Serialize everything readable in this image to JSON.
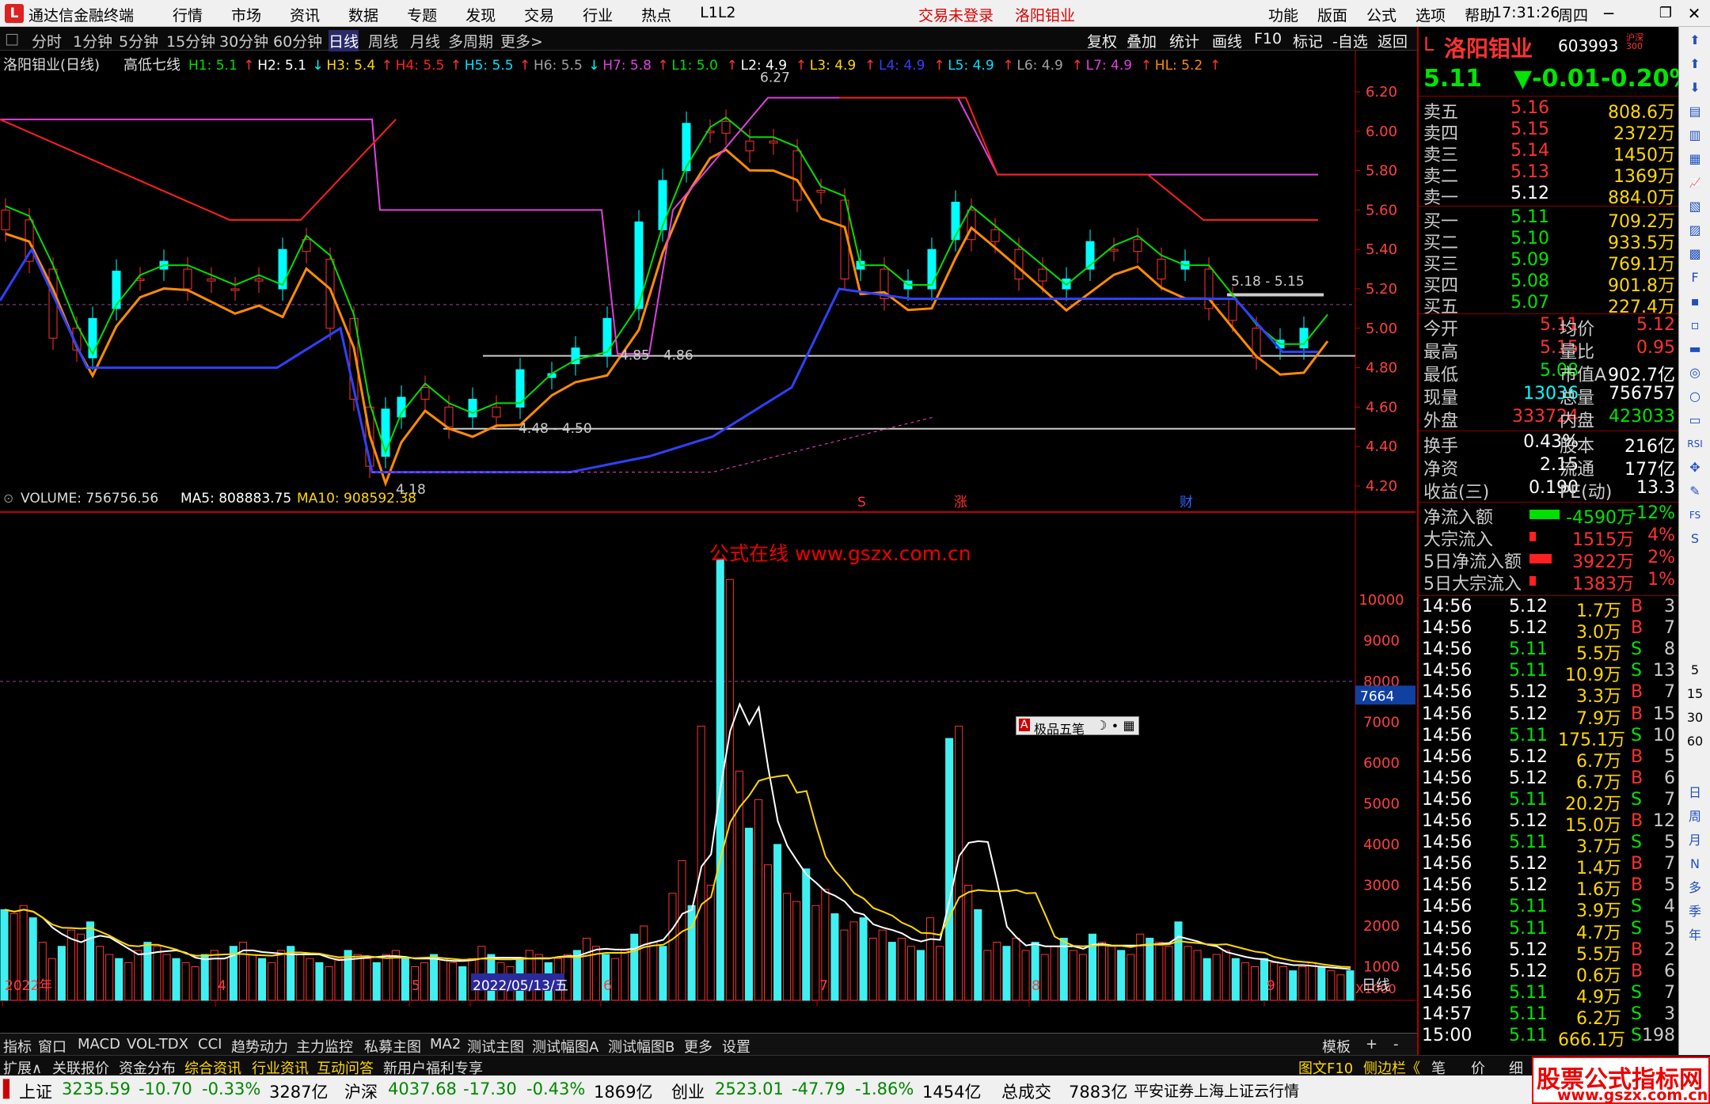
{
  "titlebar": {
    "app_title": "通达信金融终端",
    "menus": [
      "行情",
      "市场",
      "资讯",
      "数据",
      "专题",
      "发现",
      "交易",
      "行业",
      "热点",
      "L1L2"
    ],
    "trade_warning": "交易未登录",
    "stock_name": "洛阳钼业",
    "right_menus": [
      "功能",
      "版面",
      "公式",
      "选项",
      "帮助"
    ],
    "time": "17:31:26",
    "weekday": "周四"
  },
  "periodbar": {
    "items": [
      "分时",
      "1分钟",
      "5分钟",
      "15分钟",
      "30分钟",
      "60分钟",
      "日线",
      "周线",
      "月线",
      "多周期",
      "更多>"
    ],
    "selected": "日线",
    "right_items": [
      "复权",
      "叠加",
      "统计",
      "画线",
      "F10",
      "标记",
      "-自选",
      "返回"
    ]
  },
  "main": {
    "title": "洛阳钼业(日线)",
    "indicator": "高低七线",
    "params": [
      {
        "label": "H1: 5.1",
        "arrow": "↑",
        "color": "#00e000"
      },
      {
        "label": "H2: 5.1",
        "arrow": "↓",
        "color": "#ffffff"
      },
      {
        "label": "H3: 5.4",
        "arrow": "↑",
        "color": "#ffd800"
      },
      {
        "label": "H4: 5.5",
        "arrow": "↑",
        "color": "#ff2020"
      },
      {
        "label": "H5: 5.5",
        "arrow": "↑",
        "color": "#00e0ff"
      },
      {
        "label": "H6: 5.5",
        "arrow": "↓",
        "color": "#a0a0a0"
      },
      {
        "label": "H7: 5.8",
        "arrow": "↑",
        "color": "#e040e0"
      },
      {
        "label": "L1: 5.0",
        "arrow": "↑",
        "color": "#00e000"
      },
      {
        "label": "L2: 4.9",
        "arrow": "↑",
        "color": "#ffffff"
      },
      {
        "label": "L3: 4.9",
        "arrow": "↑",
        "color": "#ffd800"
      },
      {
        "label": "L4: 4.9",
        "arrow": "↑",
        "color": "#3040ff"
      },
      {
        "label": "L5: 4.9",
        "arrow": "↑",
        "color": "#00e0ff"
      },
      {
        "label": "L6: 4.9",
        "arrow": "↑",
        "color": "#a0a0a0"
      },
      {
        "label": "L7: 4.9",
        "arrow": "↑",
        "color": "#e040e0"
      },
      {
        "label": "HL: 5.2",
        "arrow": "↑",
        "color": "#ff8c00"
      }
    ],
    "yticks": [
      "6.20",
      "6.00",
      "5.80",
      "5.60",
      "5.40",
      "5.20",
      "5.00",
      "4.80",
      "4.60",
      "4.40",
      "4.20"
    ],
    "annotations": {
      "high": "6.27",
      "low": "4.18",
      "range1": "4.85 - 4.86",
      "range2": "4.48 - 4.50",
      "range3": "5.18 - 5.15"
    },
    "markers": [
      "S",
      "涨",
      "财"
    ]
  },
  "volume": {
    "label": "VOLUME: 756756.56",
    "ma5": "MA5: 808883.75",
    "ma10": "MA10: 908592.38",
    "yticks": [
      "10000",
      "9000",
      "8000",
      "7000",
      "6000",
      "5000",
      "4000",
      "3000",
      "2000",
      "1000"
    ],
    "current_tag": "7664",
    "unit": "X1000",
    "watermark": "公式在线 www.gszx.com.cn"
  },
  "xaxis": {
    "labels": [
      "2022年",
      "4",
      "5",
      "2022/05/13/五",
      "6",
      "7",
      "8",
      "9"
    ],
    "right_label": "日线"
  },
  "ime": {
    "label": "极品五笔"
  },
  "quote": {
    "name": "洛阳钼业",
    "code": "603993",
    "tag": "沪深300",
    "price": "5.11",
    "change": "▼-0.01",
    "pct": "-0.20%",
    "asks": [
      {
        "label": "卖五",
        "price": "5.16",
        "vol": "808.6万"
      },
      {
        "label": "卖四",
        "price": "5.15",
        "vol": "2372万"
      },
      {
        "label": "卖三",
        "price": "5.14",
        "vol": "1450万"
      },
      {
        "label": "卖二",
        "price": "5.13",
        "vol": "1369万"
      },
      {
        "label": "卖一",
        "price": "5.12",
        "vol": "884.0万"
      }
    ],
    "bids": [
      {
        "label": "买一",
        "price": "5.11",
        "vol": "709.2万"
      },
      {
        "label": "买二",
        "price": "5.10",
        "vol": "933.5万"
      },
      {
        "label": "买三",
        "price": "5.09",
        "vol": "769.1万"
      },
      {
        "label": "买四",
        "price": "5.08",
        "vol": "901.8万"
      },
      {
        "label": "买五",
        "price": "5.07",
        "vol": "227.4万"
      }
    ],
    "stats": [
      {
        "l1": "今开",
        "v1": "5.11",
        "l2": "均价",
        "v2": "5.12"
      },
      {
        "l1": "最高",
        "v1": "5.15",
        "l2": "量比",
        "v2": "0.95"
      },
      {
        "l1": "最低",
        "v1": "5.08",
        "l2": "市值A",
        "v2": "902.7亿"
      },
      {
        "l1": "现量",
        "v1": "13036",
        "l2": "总量",
        "v2": "756757"
      },
      {
        "l1": "外盘",
        "v1": "333724",
        "l2": "内盘",
        "v2": "423033"
      }
    ],
    "stats2": [
      {
        "l1": "换手",
        "v1": "0.43%",
        "l2": "股本",
        "v2": "216亿"
      },
      {
        "l1": "净资",
        "v1": "2.15",
        "l2": "流通",
        "v2": "177亿"
      },
      {
        "l1": "收益(三)",
        "v1": "0.190",
        "l2": "PE(动)",
        "v2": "13.3"
      }
    ],
    "flows": [
      {
        "label": "净流入额",
        "value": "-4590万",
        "pct": "-12%"
      },
      {
        "label": "大宗流入",
        "value": "1515万",
        "pct": "4%"
      },
      {
        "label": "5日净流入额",
        "value": "3922万",
        "pct": "2%"
      },
      {
        "label": "5日大宗流入",
        "value": "1383万",
        "pct": "1%"
      }
    ],
    "ticks": [
      [
        "14:56",
        "5.12",
        "1.7万",
        "B",
        "3"
      ],
      [
        "14:56",
        "5.12",
        "3.0万",
        "B",
        "7"
      ],
      [
        "14:56",
        "5.11",
        "5.5万",
        "S",
        "8"
      ],
      [
        "14:56",
        "5.11",
        "10.9万",
        "S",
        "13"
      ],
      [
        "14:56",
        "5.12",
        "3.3万",
        "B",
        "7"
      ],
      [
        "14:56",
        "5.12",
        "7.9万",
        "B",
        "15"
      ],
      [
        "14:56",
        "5.11",
        "175.1万",
        "S",
        "10"
      ],
      [
        "14:56",
        "5.12",
        "6.7万",
        "B",
        "5"
      ],
      [
        "14:56",
        "5.12",
        "6.7万",
        "B",
        "6"
      ],
      [
        "14:56",
        "5.11",
        "20.2万",
        "S",
        "7"
      ],
      [
        "14:56",
        "5.12",
        "15.0万",
        "B",
        "12"
      ],
      [
        "14:56",
        "5.11",
        "3.7万",
        "S",
        "5"
      ],
      [
        "14:56",
        "5.12",
        "1.4万",
        "B",
        "7"
      ],
      [
        "14:56",
        "5.12",
        "1.6万",
        "B",
        "5"
      ],
      [
        "14:56",
        "5.11",
        "3.9万",
        "S",
        "4"
      ],
      [
        "14:56",
        "5.11",
        "4.7万",
        "S",
        "5"
      ],
      [
        "14:56",
        "5.12",
        "5.5万",
        "B",
        "2"
      ],
      [
        "14:56",
        "5.12",
        "0.6万",
        "B",
        "6"
      ],
      [
        "14:56",
        "5.11",
        "4.9万",
        "S",
        "7"
      ],
      [
        "14:57",
        "5.11",
        "6.2万",
        "S",
        "3"
      ],
      [
        "15:00",
        "5.11",
        "666.1万",
        "S",
        "198"
      ]
    ]
  },
  "tools": [
    "日",
    "周",
    "月",
    "N",
    "多",
    "季",
    "年"
  ],
  "tools_nums": [
    "5",
    "15",
    "30",
    "60"
  ],
  "bottom_tabs": [
    "指标",
    "窗口",
    "MACD",
    "VOL-TDX",
    "CCI",
    "趋势动力",
    "主力监控",
    "私募主图",
    "MA2",
    "测试主图",
    "测试幅图A",
    "测试幅图B",
    "更多",
    "设置"
  ],
  "bottom_tabs_right": [
    "模板",
    "+",
    "-"
  ],
  "bottom_tabs2": [
    "扩展∧",
    "关联报价",
    "资金分布",
    "综合资讯",
    "行业资讯",
    "互动问答",
    "新用户福利专享"
  ],
  "bottom_tabs2_right": [
    "图文F10",
    "侧边栏《",
    "笔",
    "价",
    "细",
    "势"
  ],
  "statusbar": {
    "sh_label": "上证",
    "sh": "3235.59",
    "sh_ch": "-10.70",
    "sh_pct": "-0.33%",
    "sh_amt": "3287亿",
    "hs_label": "沪深",
    "hs": "4037.68",
    "hs_ch": "-17.30",
    "hs_pct": "-0.43%",
    "hs_amt": "1869亿",
    "cy_label": "创业",
    "cy": "2523.01",
    "cy_ch": "-47.79",
    "cy_pct": "-1.86%",
    "cy_amt": "1454亿",
    "total_label": "总成交",
    "total": "7883亿",
    "broker": "平安证券上海上证云行情"
  },
  "watermark": {
    "line1": "股票公式指标网",
    "line2": "www.gszx.com.cn"
  },
  "colors": {
    "up": "#ff3232",
    "down": "#00ffff",
    "ma5": "#ffffff",
    "ma10": "#ffd800",
    "bg": "#000000"
  }
}
